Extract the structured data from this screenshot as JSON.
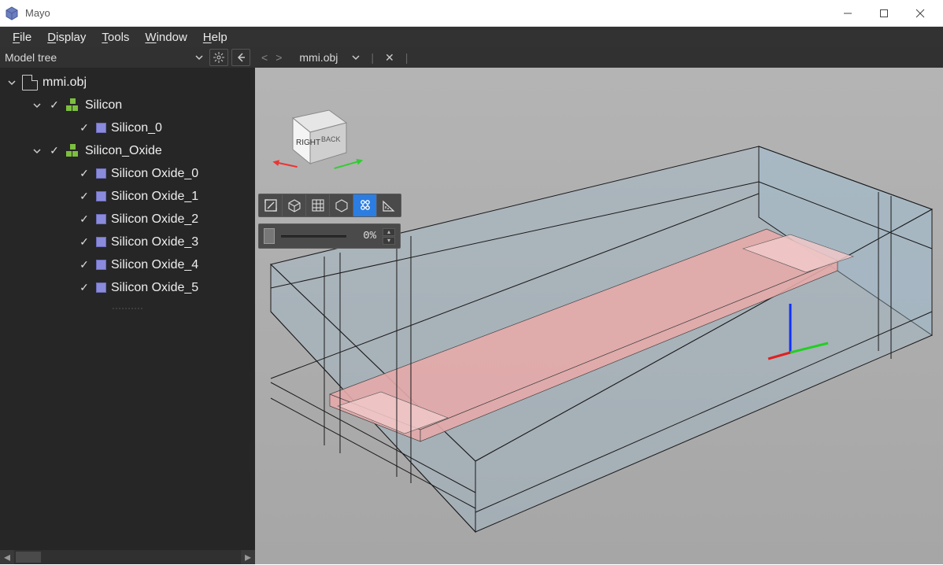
{
  "window": {
    "title": "Mayo"
  },
  "menu": {
    "file": "File",
    "display": "Display",
    "tools": "Tools",
    "window": "Window",
    "help": "Help"
  },
  "panel": {
    "title": "Model tree"
  },
  "tree": {
    "root": {
      "name": "mmi.obj"
    },
    "groups": [
      {
        "name": "Silicon",
        "children": [
          {
            "name": "Silicon_0"
          }
        ]
      },
      {
        "name": "Silicon_Oxide",
        "children": [
          {
            "name": "Silicon Oxide_0"
          },
          {
            "name": "Silicon Oxide_1"
          },
          {
            "name": "Silicon Oxide_2"
          },
          {
            "name": "Silicon Oxide_3"
          },
          {
            "name": "Silicon Oxide_4"
          },
          {
            "name": "Silicon Oxide_5"
          }
        ]
      }
    ]
  },
  "tab": {
    "name": "mmi.obj"
  },
  "navcube": {
    "face_front": "RIGHT",
    "face_side": "BACK"
  },
  "slider": {
    "value": "0%"
  }
}
